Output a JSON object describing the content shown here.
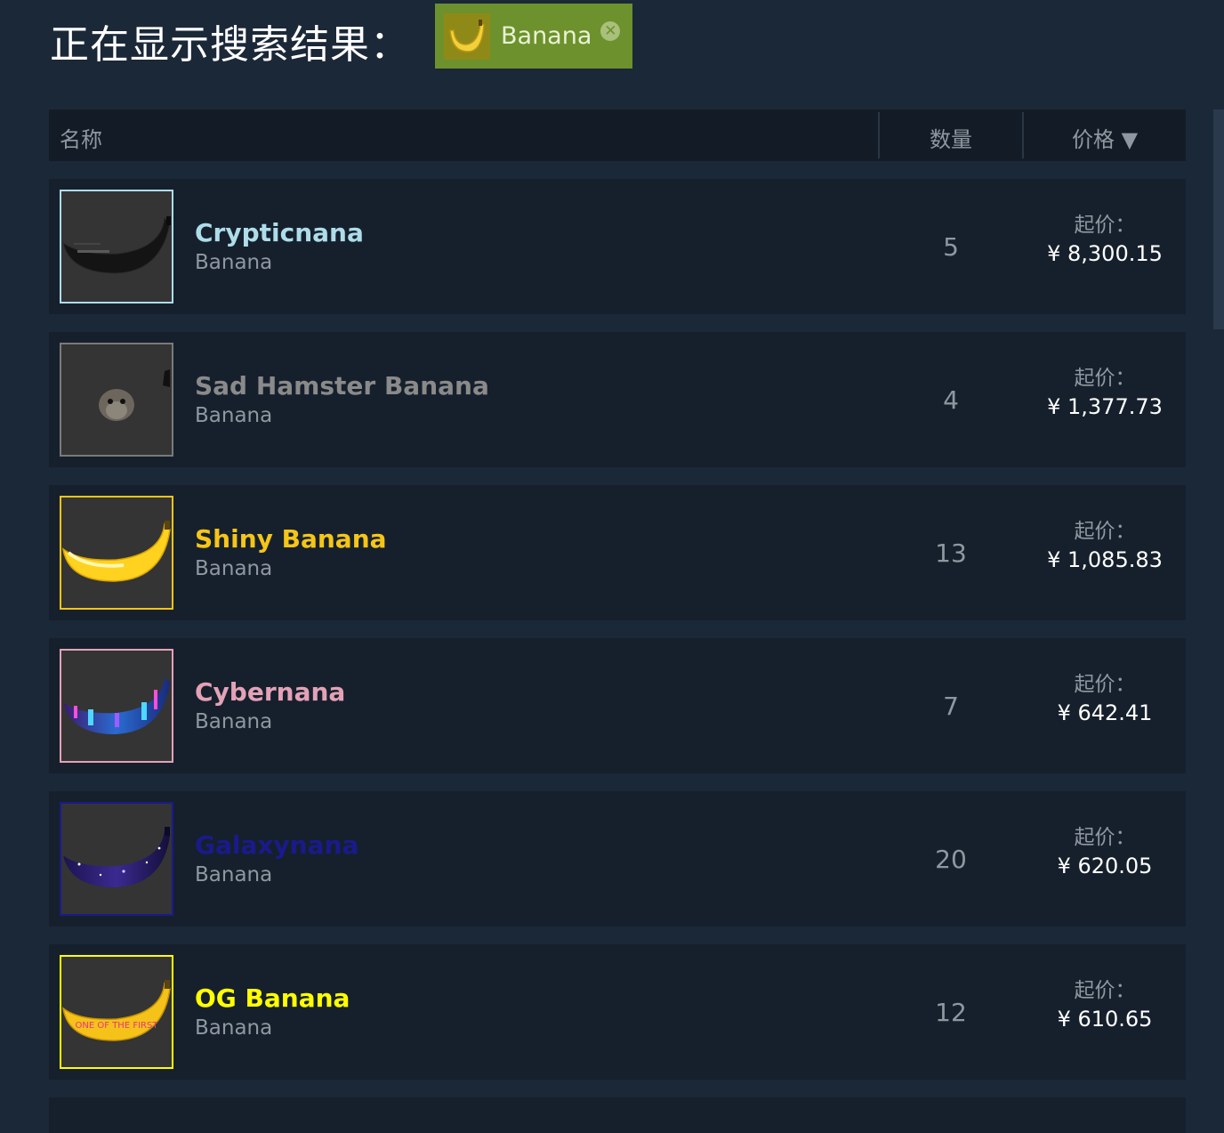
{
  "header": {
    "title": "正在显示搜索结果：",
    "filter_tag": {
      "label": "Banana",
      "remove_icon": "close-circle-icon"
    }
  },
  "columns": {
    "name": "名称",
    "quantity": "数量",
    "price": "价格",
    "price_sort_arrow": "▼"
  },
  "listings": [
    {
      "item_name": "Crypticnana",
      "game": "Banana",
      "quantity": "5",
      "price_label": "起价：",
      "price": "¥ 8,300.15",
      "name_color": "#aedce9",
      "border_color": "#aedce9",
      "icon": "black-banana-icon"
    },
    {
      "item_name": "Sad Hamster Banana",
      "game": "Banana",
      "quantity": "4",
      "price_label": "起价：",
      "price": "¥ 1,377.73",
      "name_color": "#8a8a8a",
      "border_color": "#7a7a7a",
      "icon": "hamster-banana-icon"
    },
    {
      "item_name": "Shiny Banana",
      "game": "Banana",
      "quantity": "13",
      "price_label": "起价：",
      "price": "¥ 1,085.83",
      "name_color": "#f5c518",
      "border_color": "#f5c518",
      "icon": "yellow-banana-icon"
    },
    {
      "item_name": "Cybernana",
      "game": "Banana",
      "quantity": "7",
      "price_label": "起价：",
      "price": "¥ 642.41",
      "name_color": "#e3a2b6",
      "border_color": "#e3a2b6",
      "icon": "cyber-city-banana-icon"
    },
    {
      "item_name": "Galaxynana",
      "game": "Banana",
      "quantity": "20",
      "price_label": "起价：",
      "price": "¥ 620.05",
      "name_color": "#1a1a8c",
      "border_color": "#1a1a8c",
      "icon": "galaxy-banana-icon"
    },
    {
      "item_name": "OG Banana",
      "game": "Banana",
      "quantity": "12",
      "price_label": "起价：",
      "price": "¥ 610.65",
      "name_color": "#ffff00",
      "border_color": "#ffff00",
      "icon": "og-banana-icon",
      "icon_text": "ONE OF THE FIRST"
    }
  ]
}
